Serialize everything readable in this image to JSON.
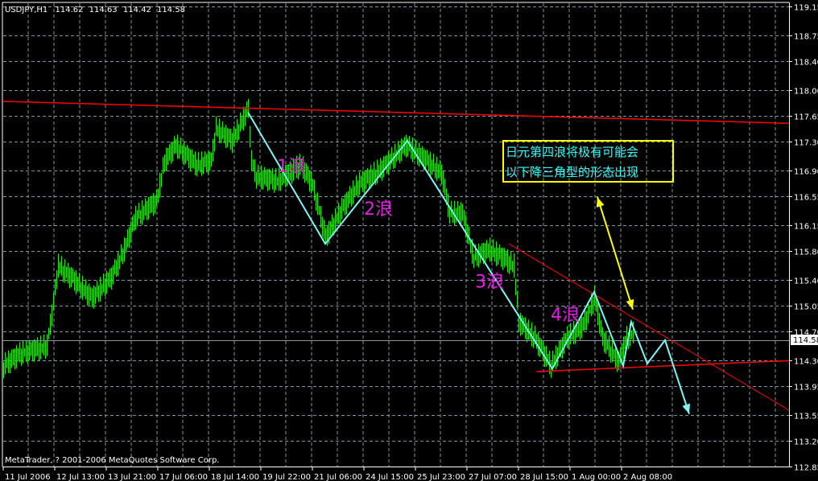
{
  "header": {
    "symbol": "USDJPY,H1",
    "open": "114.62",
    "high": "114.63",
    "low": "114.42",
    "close": "114.58"
  },
  "copyright": "MetaTrader, ? 2001-2006 MetaQuotes Software Corp.",
  "colors": {
    "background": "#000000",
    "bars": "#33dd22",
    "grid": "#7f93a0",
    "wave": "#7ff5f5",
    "trendline": "#ff0000",
    "arrow": "#ffff00",
    "label": "#e020e0",
    "note_text": "#33ffff",
    "note_border": "#ffff00",
    "bid_line": "#8a96a0"
  },
  "chart_data": {
    "type": "ohlc",
    "title": "USDJPY,H1",
    "timeframe": "H1",
    "ylim": [
      112.85,
      119.15
    ],
    "y_ticks": [
      "119.15",
      "118.75",
      "118.40",
      "118.00",
      "117.65",
      "117.30",
      "116.90",
      "116.55",
      "116.15",
      "115.80",
      "115.40",
      "115.05",
      "114.70",
      "114.30",
      "113.95",
      "113.55",
      "113.20",
      "112.85"
    ],
    "current_price": "114.58",
    "x_ticks": [
      "11 Jul 2006",
      "12 Jul 13:00",
      "13 Jul 21:00",
      "17 Jul 06:00",
      "18 Jul 14:00",
      "19 Jul 22:00",
      "21 Jul 06:00",
      "24 Jul 15:00",
      "25 Jul 23:00",
      "27 Jul 07:00",
      "28 Jul 15:00",
      "1 Aug 00:00",
      "2 Aug 08:00"
    ],
    "bars_per_x_tick": 32,
    "grid": true,
    "price_path": [
      [
        0,
        114.23
      ],
      [
        10,
        114.39
      ],
      [
        27,
        114.5
      ],
      [
        30,
        114.94
      ],
      [
        34,
        115.6
      ],
      [
        45,
        115.38
      ],
      [
        55,
        115.16
      ],
      [
        67,
        115.44
      ],
      [
        75,
        115.82
      ],
      [
        82,
        116.26
      ],
      [
        95,
        116.48
      ],
      [
        100,
        117.03
      ],
      [
        107,
        117.25
      ],
      [
        120,
        116.98
      ],
      [
        129,
        117.03
      ],
      [
        132,
        117.48
      ],
      [
        142,
        117.31
      ],
      [
        152,
        117.75
      ],
      [
        154,
        117.03
      ],
      [
        157,
        116.82
      ],
      [
        170,
        116.76
      ],
      [
        185,
        116.98
      ],
      [
        192,
        116.7
      ],
      [
        200,
        115.99
      ],
      [
        210,
        116.37
      ],
      [
        220,
        116.7
      ],
      [
        235,
        116.93
      ],
      [
        250,
        117.25
      ],
      [
        260,
        117.09
      ],
      [
        272,
        116.87
      ],
      [
        277,
        116.32
      ],
      [
        285,
        116.32
      ],
      [
        292,
        115.71
      ],
      [
        302,
        115.82
      ],
      [
        310,
        115.71
      ],
      [
        317,
        115.6
      ],
      [
        320,
        114.83
      ],
      [
        330,
        114.61
      ],
      [
        340,
        114.23
      ],
      [
        350,
        114.61
      ],
      [
        360,
        114.78
      ],
      [
        367,
        115.16
      ],
      [
        372,
        114.61
      ],
      [
        382,
        114.28
      ],
      [
        387,
        114.61
      ],
      [
        391,
        114.67
      ]
    ],
    "annotations": {
      "wave_path": [
        [
          152,
          117.7
        ],
        [
          200,
          115.9
        ],
        [
          251,
          117.31
        ],
        [
          341,
          114.19
        ],
        [
          367,
          115.24
        ],
        [
          385,
          114.23
        ],
        [
          390,
          114.83
        ],
        [
          400,
          114.26
        ],
        [
          411,
          114.58
        ],
        [
          426,
          113.57
        ]
      ],
      "trendlines": [
        {
          "name": "upper-resistance",
          "from": [
            0,
            117.85
          ],
          "to": [
            488,
            117.55
          ]
        },
        {
          "name": "triangle-upper",
          "from": [
            314,
            115.9
          ],
          "to": [
            488,
            113.62
          ]
        },
        {
          "name": "triangle-lower",
          "from": [
            331,
            114.15
          ],
          "to": [
            488,
            114.3
          ]
        }
      ],
      "double_arrow": {
        "from": [
          369,
          116.54
        ],
        "to": [
          391,
          115.0
        ]
      },
      "wave_labels": [
        {
          "text": "1浪",
          "at": [
            170,
            116.88
          ]
        },
        {
          "text": "2浪",
          "at": [
            224,
            116.3
          ]
        },
        {
          "text": "3浪",
          "at": [
            293,
            115.3
          ]
        },
        {
          "text": "4浪",
          "at": [
            340,
            114.85
          ]
        }
      ],
      "note": {
        "lines": [
          "日元第四浪将极有可能会",
          "以下降三角型的形态出现"
        ]
      }
    }
  }
}
